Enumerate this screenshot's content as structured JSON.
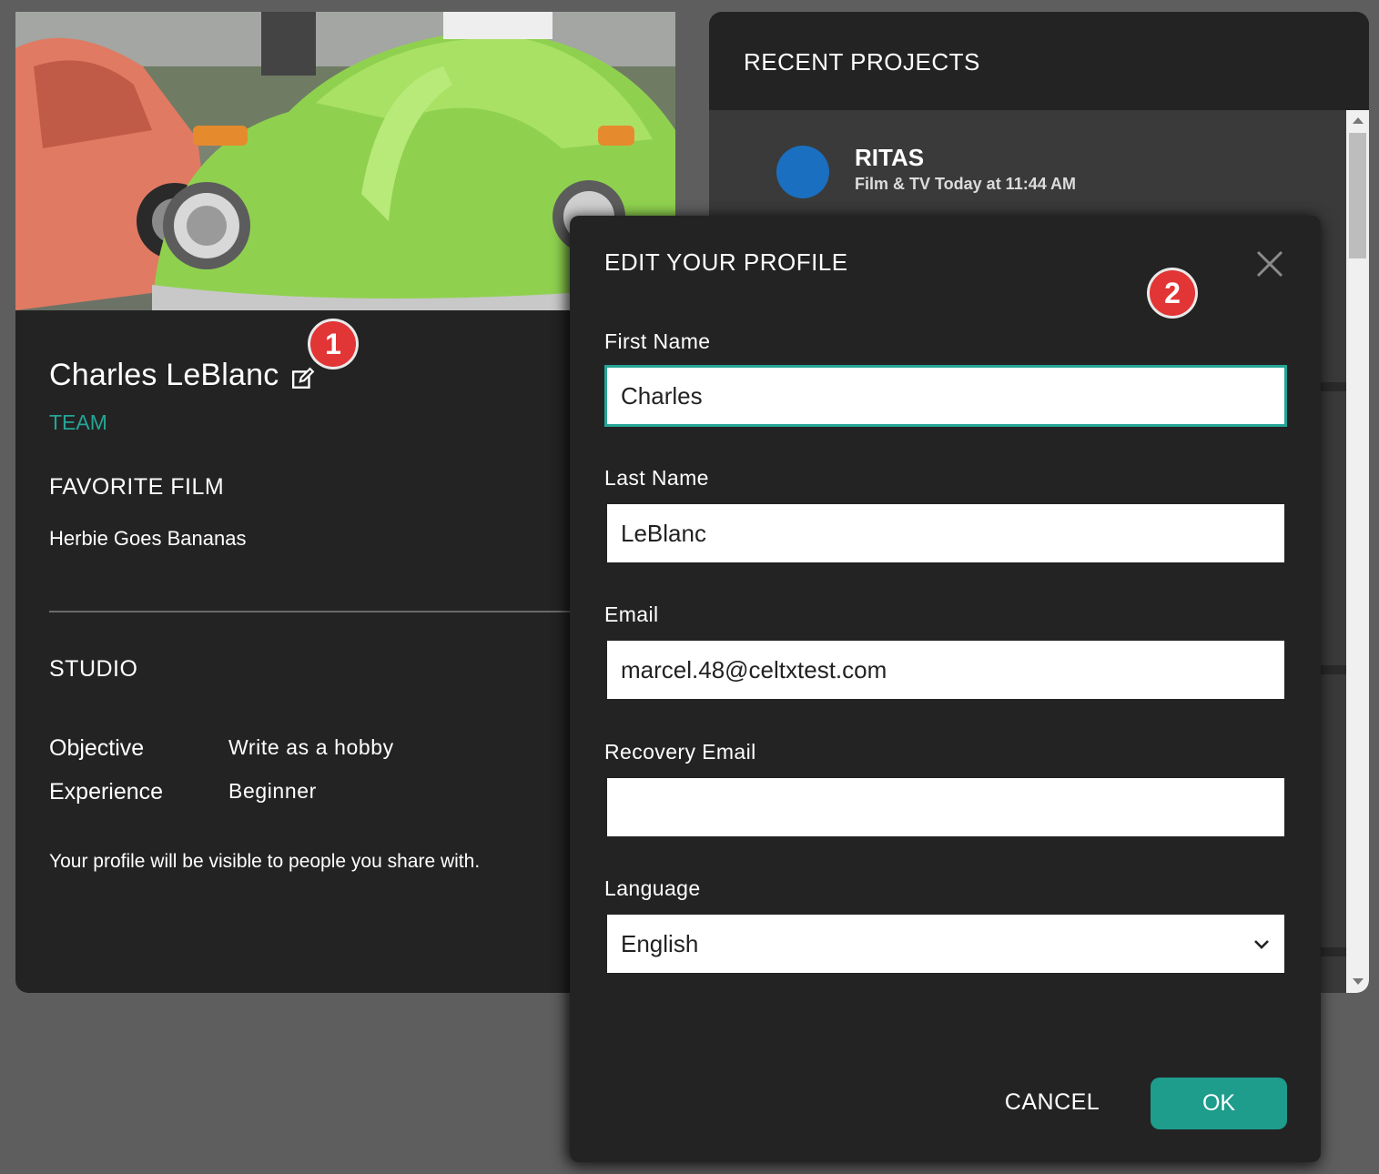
{
  "profile": {
    "name": "Charles LeBlanc",
    "role": "TEAM",
    "favorite_film_title": "FAVORITE FILM",
    "favorite_film": "Herbie Goes Bananas",
    "studio_title": "STUDIO",
    "objective_label": "Objective",
    "objective_value": "Write as a hobby",
    "experience_label": "Experience",
    "experience_value": "Beginner",
    "visibility_note": "Your profile will be visible to people you share with."
  },
  "annotations": {
    "badge1": "1",
    "badge2": "2"
  },
  "projects": {
    "title": "RECENT PROJECTS",
    "items": [
      {
        "name": "RITAS",
        "meta": "Film & TV Today at 11:44 AM",
        "color": "#1b6fc0"
      }
    ]
  },
  "dialog": {
    "title": "EDIT YOUR PROFILE",
    "first_name_label": "First Name",
    "first_name_value": "Charles",
    "last_name_label": "Last Name",
    "last_name_value": "LeBlanc",
    "email_label": "Email",
    "email_value": "marcel.48@celtxtest.com",
    "recovery_email_label": "Recovery Email",
    "recovery_email_value": "",
    "language_label": "Language",
    "language_value": "English",
    "cancel_label": "CANCEL",
    "ok_label": "OK"
  },
  "colors": {
    "accent": "#25a596",
    "ok_button": "#1e9c8c",
    "badge": "#e23535",
    "panel": "#232323",
    "backdrop": "#5e5e5e"
  },
  "icons": {
    "edit": "pencil-square-icon",
    "close": "close-icon",
    "dropdown": "chevron-down-icon"
  }
}
